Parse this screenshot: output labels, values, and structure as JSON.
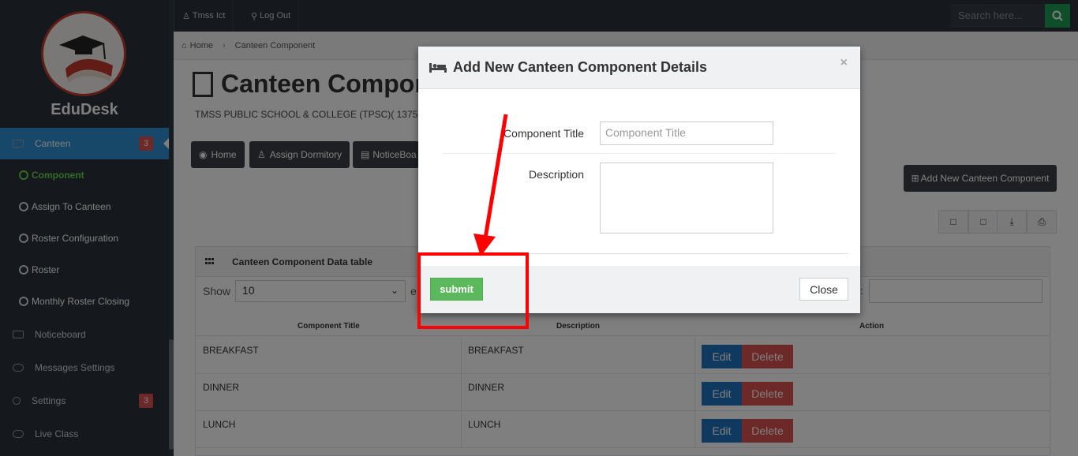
{
  "sidebar": {
    "brand": "EduDesk",
    "canteen": {
      "label": "Canteen",
      "badge": "3"
    },
    "subitems": [
      "Component",
      "Assign To Canteen",
      "Roster Configuration",
      "Roster",
      "Monthly Roster Closing"
    ],
    "noticeboard": "Noticeboard",
    "messages": "Messages Settings",
    "settings": {
      "label": "Settings",
      "badge": "3"
    },
    "live_class": "Live Class"
  },
  "topbar": {
    "user": "Tmss Ict",
    "logout": "Log Out",
    "search_placeholder": "Search here..."
  },
  "breadcrumb": {
    "home": "Home",
    "current": "Canteen Component"
  },
  "page": {
    "title": "Canteen Compor",
    "school": "TMSS PUBLIC SCHOOL & COLLEGE (TPSC)( 1375"
  },
  "nav": {
    "home": "Home",
    "assign_dormitory": "Assign Dormitory",
    "noticeboard": "NoticeBoa"
  },
  "add_button": "Add New Canteen Component",
  "panel": {
    "title": "Canteen Component Data table",
    "show_label": "Show",
    "show_value": "10",
    "entries_frag": "e",
    "columns": [
      "Component Title",
      "Description",
      "Action"
    ],
    "rows": [
      {
        "title": "BREAKFAST",
        "description": "BREAKFAST"
      },
      {
        "title": "DINNER",
        "description": "DINNER"
      },
      {
        "title": "LUNCH",
        "description": "LUNCH"
      }
    ],
    "edit_label": "Edit",
    "delete_label": "Delete"
  },
  "modal": {
    "title": "Add New Canteen Component Details",
    "close_x": "×",
    "component_title_label": "Component Title",
    "component_title_placeholder": "Component Title",
    "description_label": "Description",
    "submit": "submit",
    "close": "Close"
  },
  "annotation_color": "#ff0000"
}
